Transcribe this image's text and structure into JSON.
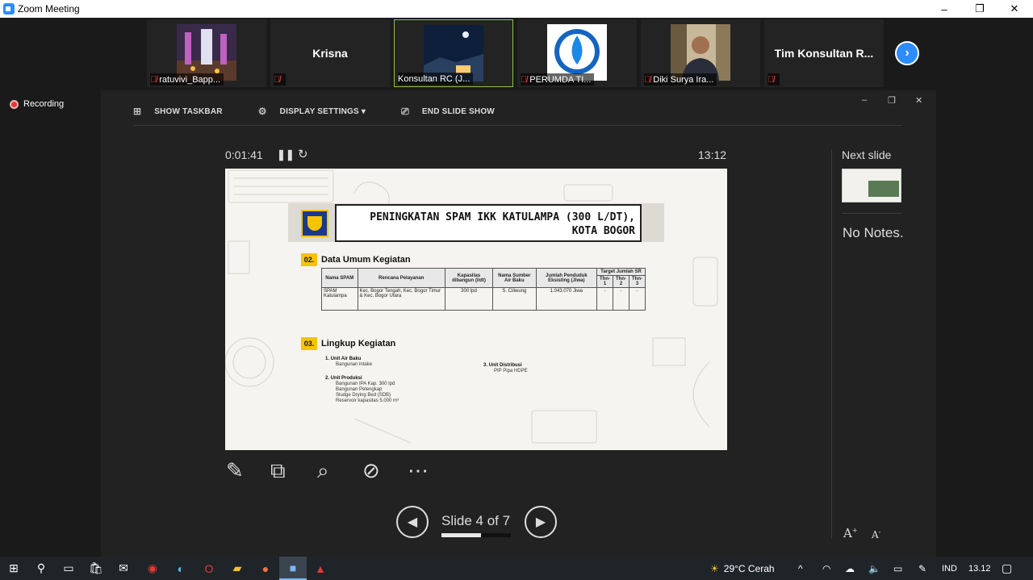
{
  "window": {
    "title": "Zoom Meeting",
    "minimize": "–",
    "restore": "❐",
    "close": "✕"
  },
  "gallery": {
    "tiles": [
      {
        "name": "ratuvivi_Bapp...",
        "big": ""
      },
      {
        "name": "",
        "big": "Krisna"
      },
      {
        "name": "Konsultan RC (J...",
        "big": ""
      },
      {
        "name": "PERUMDA TI...",
        "big": ""
      },
      {
        "name": "Diki Surya Ira...",
        "big": ""
      },
      {
        "name": "",
        "big": "Tim Konsultan R..."
      }
    ],
    "next_icon": "›"
  },
  "recording": {
    "label": "Recording"
  },
  "presenter": {
    "toolbar": {
      "show_taskbar": "SHOW TASKBAR",
      "display_settings": "DISPLAY SETTINGS ▾",
      "end_slide_show": "END SLIDE SHOW"
    },
    "window_controls": {
      "min": "–",
      "restore": "❐",
      "close": "✕"
    },
    "timer": "0:01:41",
    "clock": "13:12",
    "slide_counter": "Slide 4 of 7",
    "progress": 0.571,
    "next_slide_label": "Next slide",
    "notes": "No Notes.",
    "font_increase": "A",
    "font_decrease": "A"
  },
  "slide": {
    "title_line1": "PENINGKATAN SPAM IKK KATULAMPA (300 L/DT),",
    "title_line2": "KOTA BOGOR",
    "section2_num": "02.",
    "section2_title": "Data Umum Kegiatan",
    "table_headers": [
      "Nama SPAM",
      "Rencana Pelayanan",
      "Kapasitas dibangun (l/dt)",
      "Nama Sumber Air Baku",
      "Jumlah Penduduk Eksisting (Jiwa)",
      "Target Jumlah SR",
      "Thn-1",
      "Thn-2",
      "Thn-3"
    ],
    "table_row": [
      "SPAM Katulampa",
      "Kec. Bogor Tengah, Kec. Bogor Timur & Kec. Bogor Utara",
      "300 lpd",
      "S. Ciliwung",
      "1.043.070 Jiwa",
      "-",
      "-",
      "-"
    ],
    "section3_num": "03.",
    "section3_title": "Lingkup Kegiatan",
    "item1_title": "1.    Unit Air Baku",
    "item1_sub": "Bangunan intake",
    "item2_title": "2.    Unit Produksi",
    "item2_sub1": "Bangunan IPA Kap. 300 lpd",
    "item2_sub2": "Bangunan Pelengkap",
    "item2_sub3": "Sludge Drying Bed (SDB)",
    "item2_sub4": "Reservoir kapasitas 5.000 m³",
    "item3_title": "3.    Unit Distribusi",
    "item3_sub": "PIP Pipa HDPE"
  },
  "taskbar": {
    "weather": "29°C  Cerah",
    "language": "IND",
    "time": "13.12"
  }
}
